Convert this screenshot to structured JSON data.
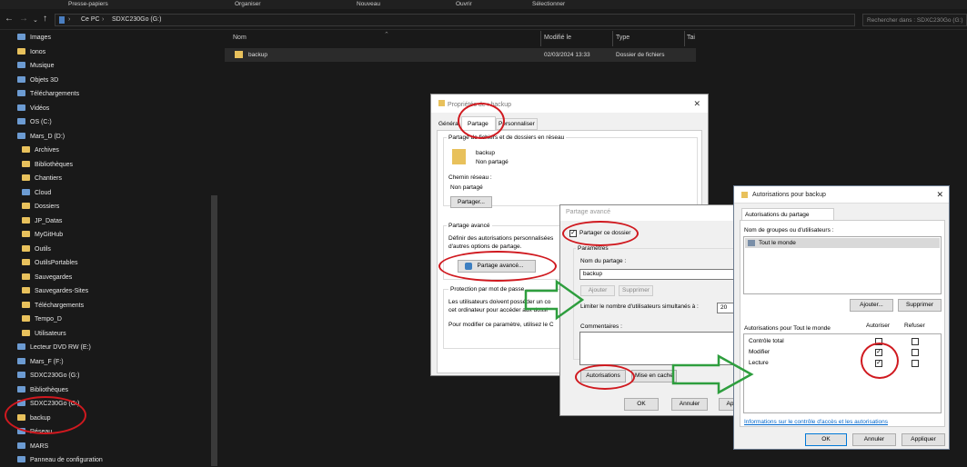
{
  "ribbon": {
    "presse": "Presse-papiers",
    "organiser": "Organiser",
    "nouveau": "Nouveau",
    "ouvrir": "Ouvrir",
    "selectionner": "Sélectionner"
  },
  "breadcrumb": {
    "ce_pc": "Ce PC",
    "sep": "›",
    "drive": "SDXC230Go (G:)"
  },
  "search_placeholder": "Rechercher dans : SDXC230Go (G:)",
  "sidebar": [
    {
      "label": "Images",
      "icon": "images-icon"
    },
    {
      "label": "Ionos",
      "icon": "folder-icon"
    },
    {
      "label": "Musique",
      "icon": "music-icon"
    },
    {
      "label": "Objets 3D",
      "icon": "objects3d-icon"
    },
    {
      "label": "Téléchargements",
      "icon": "download-icon"
    },
    {
      "label": "Vidéos",
      "icon": "video-icon"
    },
    {
      "label": "OS (C:)",
      "icon": "drive-icon"
    },
    {
      "label": "Mars_D (D:)",
      "icon": "drive-icon"
    },
    {
      "label": "Archives",
      "icon": "folder-icon"
    },
    {
      "label": "Bibliothèques",
      "icon": "folder-icon"
    },
    {
      "label": "Chantiers",
      "icon": "folder-icon"
    },
    {
      "label": "Cloud",
      "icon": "cloud-icon"
    },
    {
      "label": "Dossiers",
      "icon": "folder-icon"
    },
    {
      "label": "JP_Datas",
      "icon": "folder-icon"
    },
    {
      "label": "MyGitHub",
      "icon": "folder-icon"
    },
    {
      "label": "Outils",
      "icon": "folder-icon"
    },
    {
      "label": "OutilsPortables",
      "icon": "folder-icon"
    },
    {
      "label": "Sauvegardes",
      "icon": "folder-check-icon"
    },
    {
      "label": "Sauvegardes-Sites",
      "icon": "folder-icon"
    },
    {
      "label": "Téléchargements",
      "icon": "folder-icon"
    },
    {
      "label": "Tempo_D",
      "icon": "folder-icon"
    },
    {
      "label": "Utilisateurs",
      "icon": "folder-icon"
    },
    {
      "label": "Lecteur DVD RW (E:)",
      "icon": "dvd-icon"
    },
    {
      "label": "Mars_F (F:)",
      "icon": "drive-icon"
    },
    {
      "label": "SDXC230Go (G:)",
      "icon": "drive-icon"
    },
    {
      "label": "Bibliothèques",
      "icon": "library-icon"
    },
    {
      "label": "SDXC230Go (G:)",
      "icon": "drive-icon"
    },
    {
      "label": "backup",
      "icon": "folder-icon"
    },
    {
      "label": "Réseau",
      "icon": "network-icon"
    },
    {
      "label": "MARS",
      "icon": "computer-icon"
    },
    {
      "label": "Panneau de configuration",
      "icon": "control-panel-icon"
    }
  ],
  "columns": {
    "name": "Nom",
    "modified": "Modifié le",
    "type": "Type",
    "size": "Tai"
  },
  "files": [
    {
      "name": "backup",
      "modified": "02/03/2024 13:33",
      "type": "Dossier de fichiers"
    }
  ],
  "props": {
    "title": "Propriétés de : backup",
    "tabs": [
      "Général",
      "Partage",
      "Personnaliser"
    ],
    "group1": "Partage de fichiers et de dossiers en réseau",
    "folder": "backup",
    "status": "Non partagé",
    "path_label": "Chemin réseau :",
    "path_value": "Non partagé",
    "share_btn": "Partager...",
    "group2": "Partage avancé",
    "adv_desc1": "Définir des autorisations personnalisées",
    "adv_desc2": "d'autres options de partage.",
    "adv_btn": "Partage avancé...",
    "pwd_title": "Protection par mot de passe",
    "pwd1": "Les utilisateurs doivent posséder un co",
    "pwd2": "cet ordinateur pour accéder aux dossi",
    "pwd3": "Pour modifier ce paramètre, utilisez le C"
  },
  "adv": {
    "title": "Partage avancé",
    "share_cb": "Partager ce dossier",
    "params": "Paramètres",
    "name_label": "Nom du partage :",
    "name_value": "backup",
    "add": "Ajouter",
    "remove": "Supprimer",
    "limit": "Limiter le nombre d'utilisateurs simultanés à :",
    "limit_value": "20",
    "comments": "Commentaires :",
    "perms_btn": "Autorisations",
    "cache_btn": "Mise en cache",
    "ok": "OK",
    "cancel": "Annuler",
    "apply": "Ap"
  },
  "perms": {
    "title": "Autorisations pour backup",
    "tab": "Autorisations du partage",
    "groups_label": "Nom de groupes ou d'utilisateurs :",
    "user": "Tout le monde",
    "add": "Ajouter...",
    "remove": "Supprimer",
    "perm_label": "Autorisations pour Tout le monde",
    "allow": "Autoriser",
    "deny": "Refuser",
    "rows": [
      {
        "name": "Contrôle total",
        "allow": false,
        "deny": false
      },
      {
        "name": "Modifier",
        "allow": true,
        "deny": false
      },
      {
        "name": "Lecture",
        "allow": true,
        "deny": false
      }
    ],
    "link": "Informations sur le contrôle d'accès et les autorisations",
    "ok": "OK",
    "cancel": "Annuler",
    "apply": "Appliquer"
  },
  "colors": {
    "annotation_red": "#d0191f",
    "arrow_green": "#2e9e3e",
    "accent_blue": "#0078d7"
  }
}
